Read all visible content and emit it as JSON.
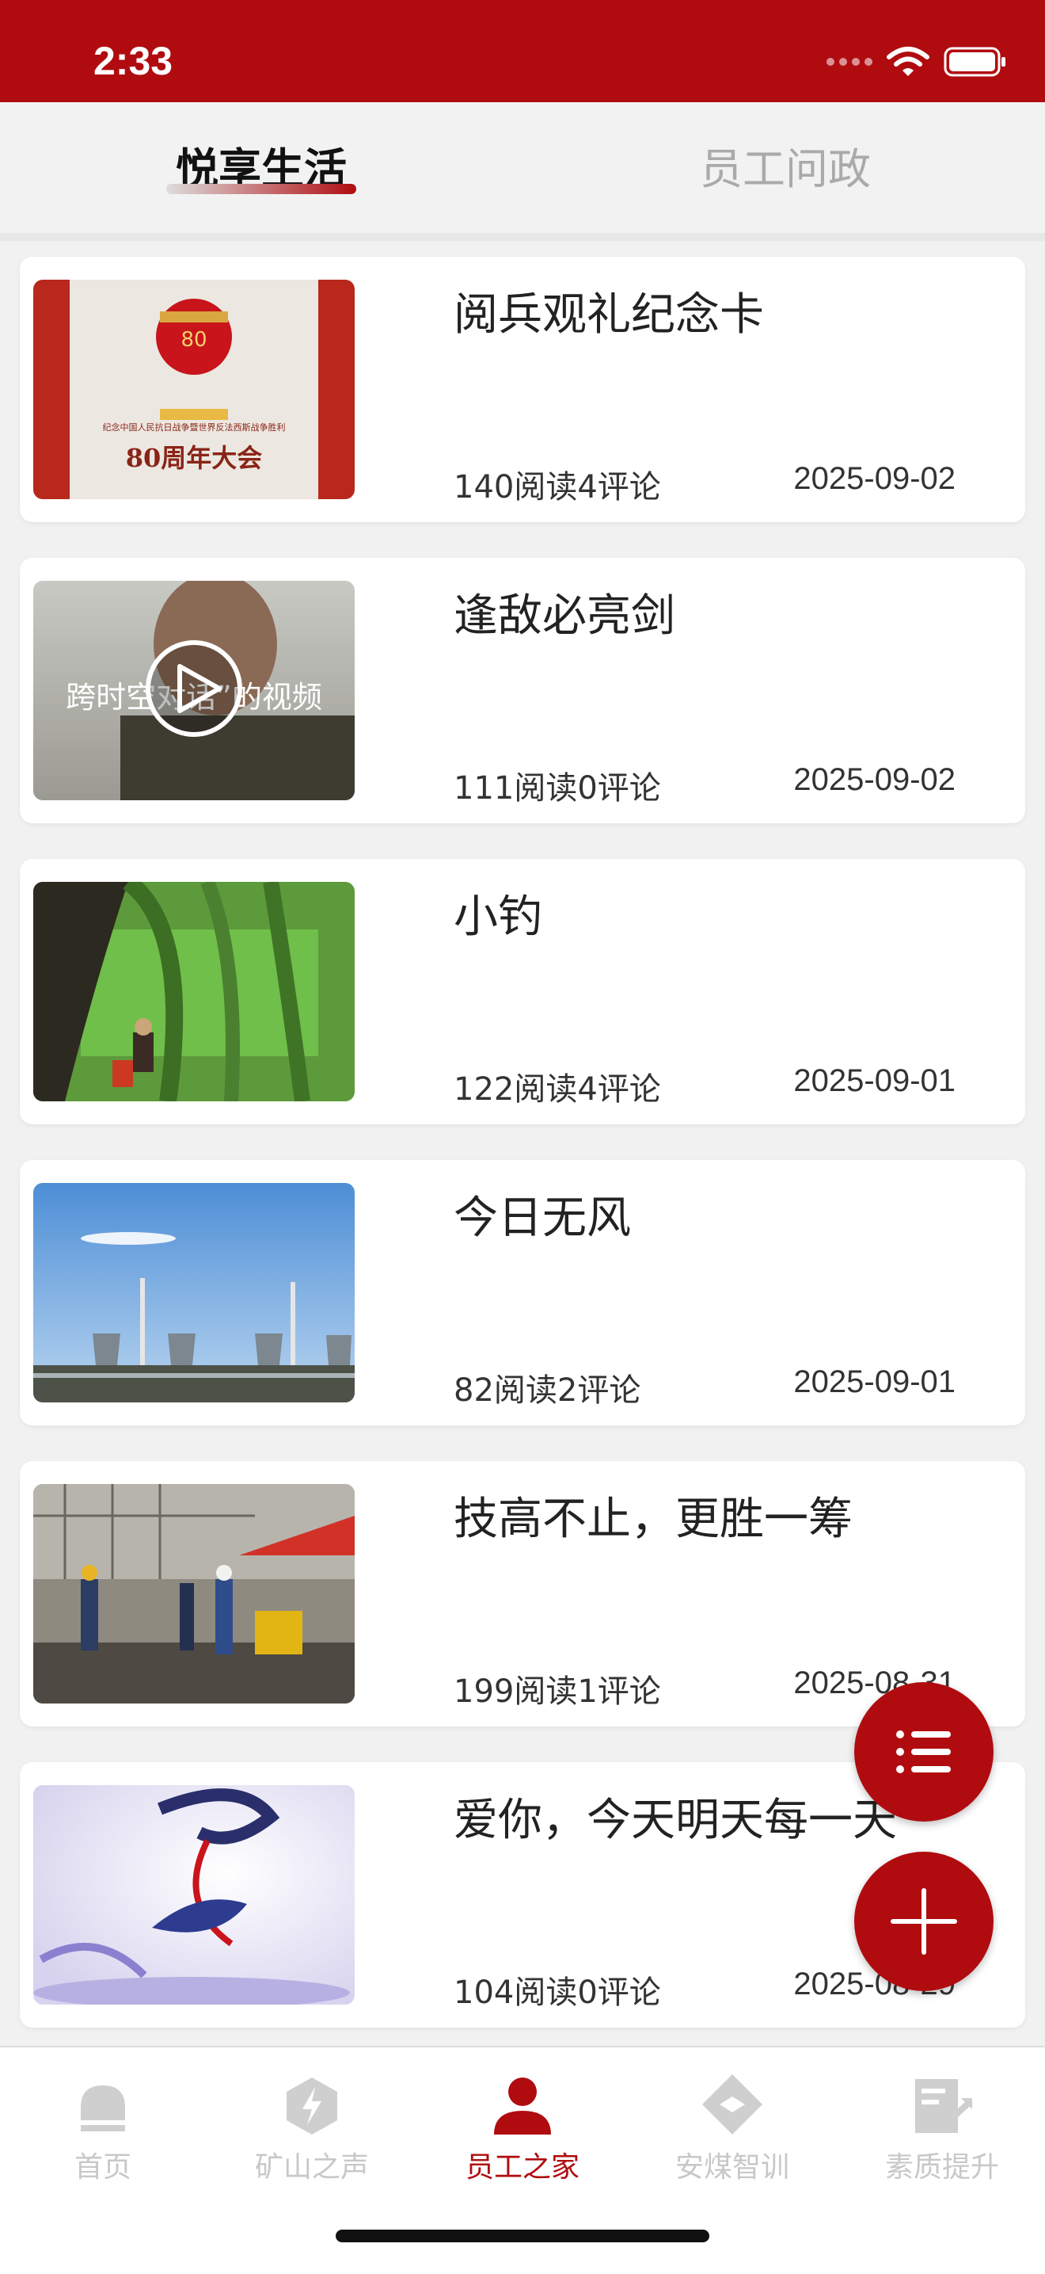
{
  "status": {
    "time": "2:33"
  },
  "tabs": [
    {
      "label": "悦享生活",
      "active": true
    },
    {
      "label": "员工问政",
      "active": false
    }
  ],
  "articles": [
    {
      "title": "阅兵观礼纪念卡",
      "stats": "140阅读4评论",
      "date": "2025-09-02",
      "thumb": "poster-red"
    },
    {
      "title": "逢敌必亮剑",
      "stats": "111阅读0评论",
      "date": "2025-09-02",
      "thumb": "video-man",
      "has_play_icon": true
    },
    {
      "title": "小钓",
      "stats": "122阅读4评论",
      "date": "2025-09-01",
      "thumb": "willow-lake"
    },
    {
      "title": "今日无风",
      "stats": "82阅读2评论",
      "date": "2025-09-01",
      "thumb": "power-plant"
    },
    {
      "title": "技高不止，更胜一筹",
      "stats": "199阅读1评论",
      "date": "2025-08-31",
      "thumb": "workshop"
    },
    {
      "title": "爱你，今天明天每一天",
      "stats": "104阅读0评论",
      "date": "2025-08-29",
      "thumb": "dancer-art"
    }
  ],
  "thumb_text": {
    "poster_line1": "纪念中国人民抗日战争暨世界反法西斯战争胜利",
    "poster_line2": "80周年大会",
    "poster_badge": "80",
    "video_caption": "跨时空对话”的视频"
  },
  "fabs": {
    "list_icon": "list-icon",
    "add_icon": "plus-icon"
  },
  "bottom_nav": [
    {
      "label": "首页",
      "icon": "home-icon",
      "active": false
    },
    {
      "label": "矿山之声",
      "icon": "lightning-icon",
      "active": false
    },
    {
      "label": "员工之家",
      "icon": "person-icon",
      "active": true
    },
    {
      "label": "安煤智训",
      "icon": "training-icon",
      "active": false
    },
    {
      "label": "素质提升",
      "icon": "growth-icon",
      "active": false
    }
  ],
  "colors": {
    "brand": "#b00c10",
    "inactive": "#c8c8c8"
  }
}
